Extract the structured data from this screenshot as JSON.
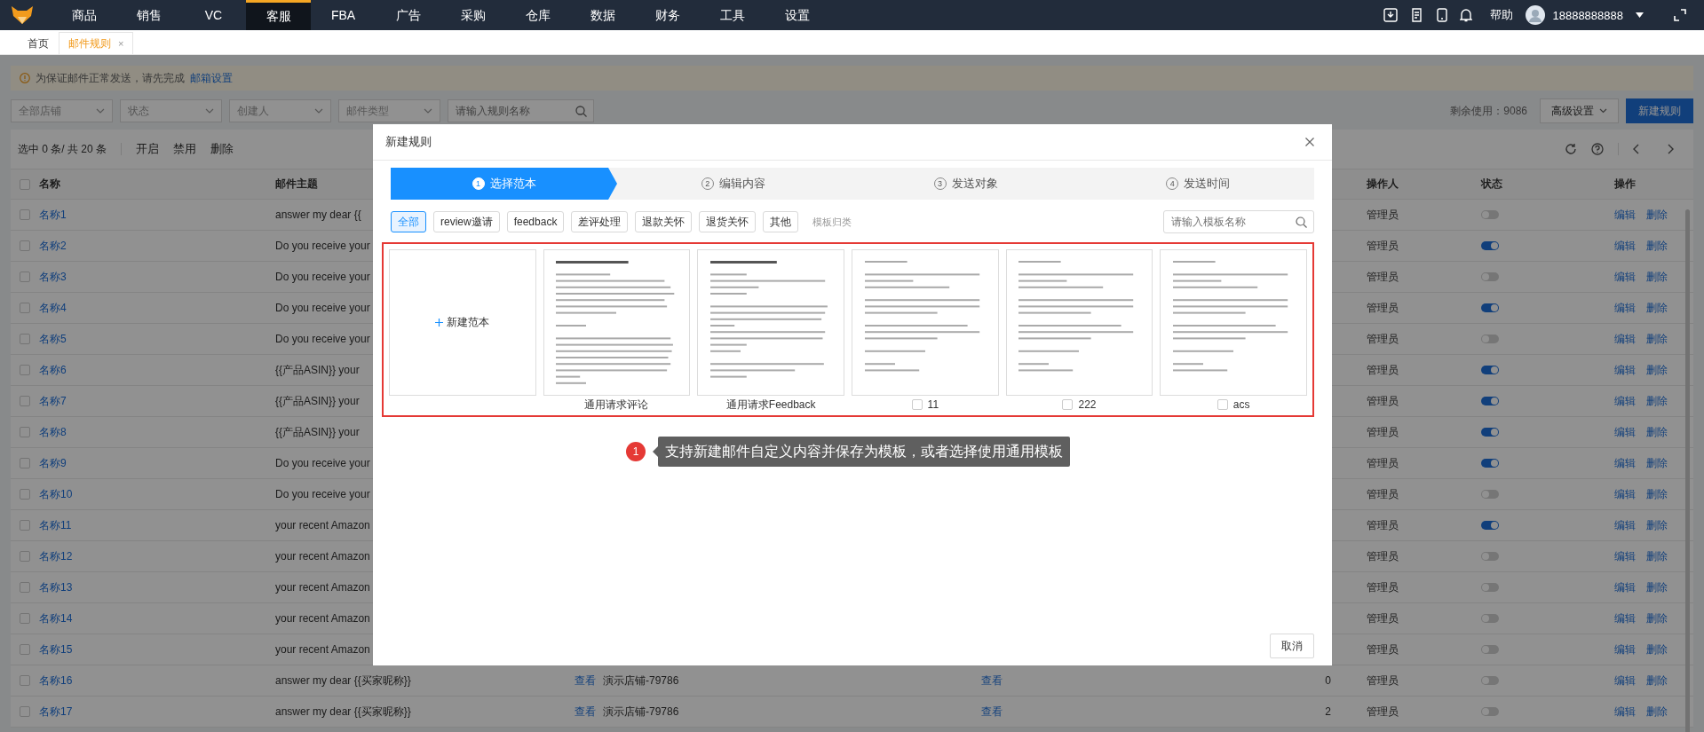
{
  "nav": {
    "items": [
      {
        "label": "商品",
        "selected": false
      },
      {
        "label": "销售",
        "selected": false
      },
      {
        "label": "VC",
        "selected": false
      },
      {
        "label": "客服",
        "selected": true
      },
      {
        "label": "FBA",
        "selected": false
      },
      {
        "label": "广告",
        "selected": false
      },
      {
        "label": "采购",
        "selected": false
      },
      {
        "label": "仓库",
        "selected": false
      },
      {
        "label": "数据",
        "selected": false
      },
      {
        "label": "财务",
        "selected": false
      },
      {
        "label": "工具",
        "selected": false
      },
      {
        "label": "设置",
        "selected": false
      }
    ],
    "help": "帮助",
    "user": "18888888888"
  },
  "tabs": [
    {
      "label": "首页",
      "selected": false
    },
    {
      "label": "邮件规则",
      "selected": true,
      "close": "×"
    }
  ],
  "notice": {
    "text": "为保证邮件正常发送，请先完成",
    "link": "邮箱设置"
  },
  "filters": {
    "selects": [
      "全部店铺",
      "状态",
      "创建人",
      "邮件类型"
    ],
    "search_placeholder": "请输入规则名称",
    "quota": "剩余使用：9086",
    "advanced": "高级设置",
    "new_button": "新建规则"
  },
  "toolbar": {
    "selection": "选中 0 条/ 共 20 条",
    "actions": [
      "开启",
      "禁用",
      "删除"
    ]
  },
  "table": {
    "all_checked": false,
    "columns": [
      "名称",
      "邮件主题",
      "操作人",
      "状态",
      "操作"
    ],
    "rows": [
      {
        "name": "名称1",
        "subject": "answer my dear {{",
        "operator": "管理员",
        "checked": false,
        "on": false,
        "actions": [
          "编辑",
          "删除"
        ]
      },
      {
        "name": "名称2",
        "subject": "Do you receive your",
        "operator": "管理员",
        "checked": false,
        "on": true,
        "actions": [
          "编辑",
          "删除"
        ]
      },
      {
        "name": "名称3",
        "subject": "Do you receive your",
        "operator": "管理员",
        "checked": false,
        "on": false,
        "actions": [
          "编辑",
          "删除"
        ]
      },
      {
        "name": "名称4",
        "subject": "Do you receive your",
        "operator": "管理员",
        "checked": false,
        "on": true,
        "actions": [
          "编辑",
          "删除"
        ]
      },
      {
        "name": "名称5",
        "subject": "Do you receive your",
        "operator": "管理员",
        "checked": false,
        "on": false,
        "actions": [
          "编辑",
          "删除"
        ]
      },
      {
        "name": "名称6",
        "subject": "{{产品ASIN}} your",
        "operator": "管理员",
        "checked": false,
        "on": true,
        "actions": [
          "编辑",
          "删除"
        ]
      },
      {
        "name": "名称7",
        "subject": "{{产品ASIN}} your",
        "operator": "管理员",
        "checked": false,
        "on": true,
        "actions": [
          "编辑",
          "删除"
        ]
      },
      {
        "name": "名称8",
        "subject": "{{产品ASIN}} your",
        "operator": "管理员",
        "checked": false,
        "on": true,
        "actions": [
          "编辑",
          "删除"
        ]
      },
      {
        "name": "名称9",
        "subject": "Do you receive your",
        "operator": "管理员",
        "checked": false,
        "on": true,
        "actions": [
          "编辑",
          "删除"
        ]
      },
      {
        "name": "名称10",
        "subject": "Do you receive your",
        "operator": "管理员",
        "checked": false,
        "on": false,
        "actions": [
          "编辑",
          "删除"
        ]
      },
      {
        "name": "名称11",
        "subject": "your recent Amazon",
        "operator": "管理员",
        "checked": false,
        "on": true,
        "actions": [
          "编辑",
          "删除"
        ]
      },
      {
        "name": "名称12",
        "subject": "your recent Amazon",
        "operator": "管理员",
        "checked": false,
        "on": false,
        "actions": [
          "编辑",
          "删除"
        ]
      },
      {
        "name": "名称13",
        "subject": "your recent Amazon",
        "operator": "管理员",
        "checked": false,
        "on": false,
        "actions": [
          "编辑",
          "删除"
        ]
      },
      {
        "name": "名称14",
        "subject": "your recent Amazon",
        "operator": "管理员",
        "checked": false,
        "on": false,
        "actions": [
          "编辑",
          "删除"
        ]
      },
      {
        "name": "名称15",
        "subject": "your recent Amazon",
        "operator": "管理员",
        "checked": false,
        "on": false,
        "actions": [
          "编辑",
          "删除"
        ]
      },
      {
        "name": "名称16",
        "subject": "answer my dear {{买家昵称}}",
        "column_3": "查看",
        "column_4": "演示店铺-79786",
        "column_5": "查看",
        "column_6": "0",
        "operator": "管理员",
        "checked": false,
        "on": false,
        "actions": [
          "编辑",
          "删除"
        ]
      },
      {
        "name": "名称17",
        "subject": "answer my dear {{买家昵称}}",
        "column_3": "查看",
        "column_4": "演示店铺-79786",
        "column_5": "查看",
        "column_6": "2",
        "operator": "管理员",
        "checked": false,
        "on": false,
        "actions": [
          "编辑",
          "删除"
        ]
      }
    ]
  },
  "modal": {
    "title": "新建规则",
    "steps": [
      {
        "num": "1",
        "label": "选择范本",
        "selected": true
      },
      {
        "num": "2",
        "label": "编辑内容",
        "selected": false
      },
      {
        "num": "3",
        "label": "发送对象",
        "selected": false
      },
      {
        "num": "4",
        "label": "发送时间",
        "selected": false
      }
    ],
    "categories": [
      {
        "label": "全部",
        "selected": true
      },
      {
        "label": "review邀请",
        "selected": false
      },
      {
        "label": "feedback",
        "selected": false
      },
      {
        "label": "差评处理",
        "selected": false
      },
      {
        "label": "退款关怀",
        "selected": false
      },
      {
        "label": "退货关怀",
        "selected": false
      },
      {
        "label": "其他",
        "selected": false
      }
    ],
    "category_link": "模板归类",
    "search_placeholder": "请输入模板名称",
    "templates": [
      {
        "kind": "new",
        "label": "新建范本"
      },
      {
        "kind": "template",
        "name": "通用请求评论"
      },
      {
        "kind": "template",
        "name": "通用请求Feedback"
      },
      {
        "kind": "template",
        "name": "11",
        "checked": false
      },
      {
        "kind": "template",
        "name": "222",
        "checked": false
      },
      {
        "kind": "template",
        "name": "acs",
        "checked": false
      }
    ],
    "callout": {
      "badge": "1",
      "text": "支持新建邮件自定义内容并保存为模板，或者选择使用通用模板"
    },
    "cancel": "取消"
  }
}
